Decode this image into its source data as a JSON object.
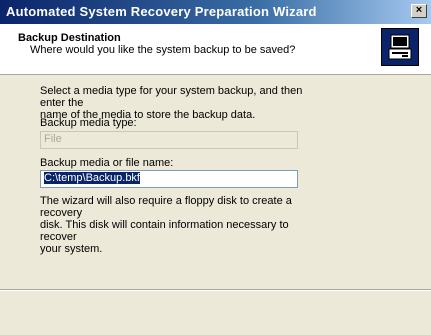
{
  "window": {
    "title": "Automated System Recovery Preparation Wizard",
    "close_label": "×"
  },
  "header": {
    "title": "Backup Destination",
    "subtitle": "Where would you like the system backup to be saved?",
    "icon": "computer-backup-icon"
  },
  "body": {
    "instructions": "Select a media type for your system backup, and then enter the\nname of the media to store the backup data.",
    "media_type_label": "Backup media type:",
    "media_type_value": "File",
    "file_name_label": "Backup media or file name:",
    "file_name_value": "C:\\temp\\Backup.bkf",
    "note": "The wizard will also require a floppy disk to create a recovery\ndisk. This disk will contain information necessary to recover\nyour system."
  },
  "colors": {
    "title_bar": "#0a246a",
    "selection": "#0a246a",
    "background": "#ece9d8"
  }
}
